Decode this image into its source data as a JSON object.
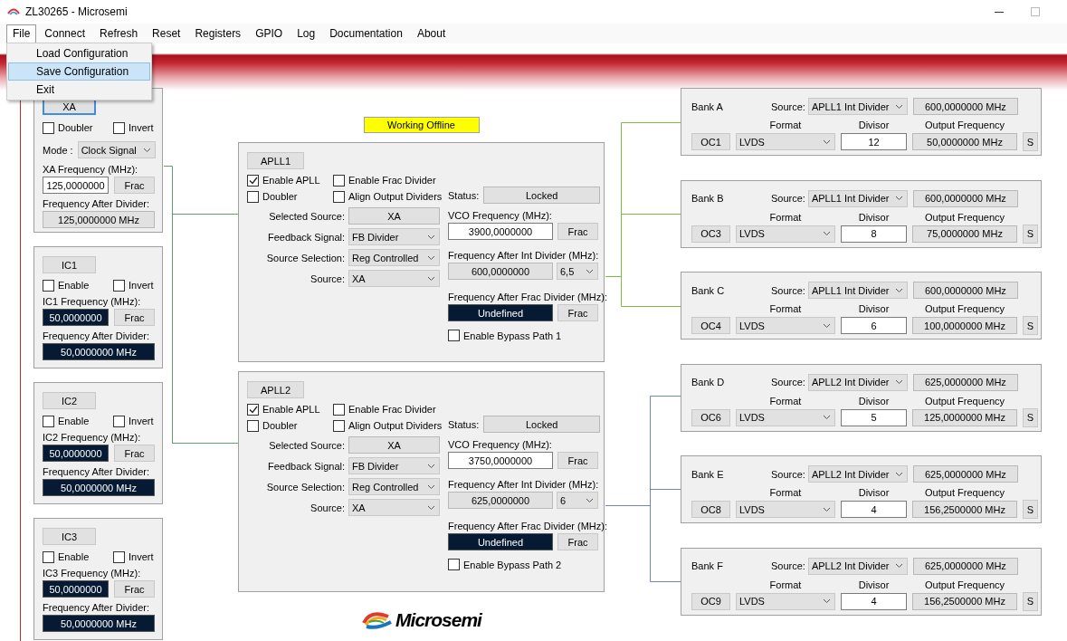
{
  "window": {
    "title": "ZL30265 - Microsemi"
  },
  "menu": [
    {
      "label": "File",
      "selected": true
    },
    {
      "label": "Connect",
      "selected": false
    },
    {
      "label": "Refresh",
      "selected": false
    },
    {
      "label": "Reset",
      "selected": false
    },
    {
      "label": "Registers",
      "selected": false
    },
    {
      "label": "GPIO",
      "selected": false
    },
    {
      "label": "Log",
      "selected": false
    },
    {
      "label": "Documentation",
      "selected": false
    },
    {
      "label": "About",
      "selected": false
    }
  ],
  "file_menu": {
    "items": [
      {
        "label": "Load Configuration",
        "selected": false
      },
      {
        "label": "Save Configuration",
        "selected": true
      },
      {
        "label": "Exit",
        "selected": false
      }
    ]
  },
  "status_badge": "Working Offline",
  "inputs": [
    {
      "kind": "crystal",
      "button": "XA",
      "focused": true,
      "checks": [
        {
          "label": "Doubler",
          "checked": false
        },
        {
          "label": "Invert",
          "checked": false
        }
      ],
      "mode_label": "Mode :",
      "mode": "Clock Signal",
      "freq_label": "XA Frequency (MHz):",
      "freq": "125,0000000",
      "frac": "Frac",
      "after_label": "Frequency After Divider:",
      "after": "125,0000000 MHz"
    },
    {
      "kind": "clock",
      "button": "IC1",
      "focused": false,
      "checks": [
        {
          "label": "Enable",
          "checked": false
        },
        {
          "label": "Invert",
          "checked": false
        }
      ],
      "freq_label": "IC1 Frequency (MHz):",
      "freq": "50,0000000",
      "frac": "Frac",
      "after_label": "Frequency After Divider:",
      "after": "50,0000000 MHz"
    },
    {
      "kind": "clock",
      "button": "IC2",
      "focused": false,
      "checks": [
        {
          "label": "Enable",
          "checked": false
        },
        {
          "label": "Invert",
          "checked": false
        }
      ],
      "freq_label": "IC2 Frequency (MHz):",
      "freq": "50,0000000",
      "frac": "Frac",
      "after_label": "Frequency After Divider:",
      "after": "50,0000000 MHz"
    },
    {
      "kind": "clock",
      "button": "IC3",
      "focused": false,
      "checks": [
        {
          "label": "Enable",
          "checked": false
        },
        {
          "label": "Invert",
          "checked": false
        }
      ],
      "freq_label": "IC3 Frequency (MHz):",
      "freq": "50,0000000",
      "frac": "Frac",
      "after_label": "Frequency After Divider:",
      "after": "50,0000000 MHz"
    }
  ],
  "aplls": [
    {
      "button": "APLL1",
      "checks": [
        {
          "label": "Enable APLL",
          "checked": true
        },
        {
          "label": "Enable Frac Divider",
          "checked": false
        },
        {
          "label": "Doubler",
          "checked": false
        },
        {
          "label": "Align Output Dividers",
          "checked": false
        }
      ],
      "rows": [
        {
          "kind": "readout",
          "label": "Selected Source:",
          "value": "XA"
        },
        {
          "kind": "dropdown",
          "label": "Feedback Signal:",
          "value": "FB Divider"
        },
        {
          "kind": "dropdown",
          "label": "Source Selection:",
          "value": "Reg Controlled"
        },
        {
          "kind": "dropdown",
          "label": "Source:",
          "value": "XA"
        }
      ],
      "status_label": "Status:",
      "status": "Locked",
      "vco_label": "VCO Frequency (MHz):",
      "vco": "3900,0000000",
      "vco_frac": "Frac",
      "int_label": "Frequency After Int Divider (MHz):",
      "int_value": "600,0000000",
      "int_divider": "6,5",
      "frac_label": "Frequency After Frac Divider (MHz):",
      "frac_value": "Undefined",
      "frac_button": "Frac",
      "bypass": {
        "label": "Enable Bypass Path 1",
        "checked": false
      }
    },
    {
      "button": "APLL2",
      "checks": [
        {
          "label": "Enable APLL",
          "checked": true
        },
        {
          "label": "Enable Frac Divider",
          "checked": false
        },
        {
          "label": "Doubler",
          "checked": false
        },
        {
          "label": "Align Output Dividers",
          "checked": false
        }
      ],
      "rows": [
        {
          "kind": "readout",
          "label": "Selected Source:",
          "value": "XA"
        },
        {
          "kind": "dropdown",
          "label": "Feedback Signal:",
          "value": "FB Divider"
        },
        {
          "kind": "dropdown",
          "label": "Source Selection:",
          "value": "Reg Controlled"
        },
        {
          "kind": "dropdown",
          "label": "Source:",
          "value": "XA"
        }
      ],
      "status_label": "Status:",
      "status": "Locked",
      "vco_label": "VCO Frequency (MHz):",
      "vco": "3750,0000000",
      "vco_frac": "Frac",
      "int_label": "Frequency After Int Divider (MHz):",
      "int_value": "625,0000000",
      "int_divider": "6",
      "frac_label": "Frequency After Frac Divider (MHz):",
      "frac_value": "Undefined",
      "frac_button": "Frac",
      "bypass": {
        "label": "Enable Bypass Path 2",
        "checked": false
      }
    }
  ],
  "logo": "Microsemi",
  "banks": [
    {
      "name": "Bank A",
      "source_label": "Source:",
      "source": "APLL1 Int Divider",
      "source_freq": "600,0000000 MHz",
      "format_label": "Format",
      "divisor_label": "Divisor",
      "output_label": "Output Frequency",
      "output": "OC1",
      "format": "LVDS",
      "divisor": "12",
      "output_freq": "50,0000000 MHz",
      "s": "S"
    },
    {
      "name": "Bank B",
      "source_label": "Source:",
      "source": "APLL1 Int Divider",
      "source_freq": "600,0000000 MHz",
      "format_label": "Format",
      "divisor_label": "Divisor",
      "output_label": "Output Frequency",
      "output": "OC3",
      "format": "LVDS",
      "divisor": "8",
      "output_freq": "75,0000000 MHz",
      "s": "S"
    },
    {
      "name": "Bank C",
      "source_label": "Source:",
      "source": "APLL1 Int Divider",
      "source_freq": "600,0000000 MHz",
      "format_label": "Format",
      "divisor_label": "Divisor",
      "output_label": "Output Frequency",
      "output": "OC4",
      "format": "LVDS",
      "divisor": "6",
      "output_freq": "100,0000000 MHz",
      "s": "S"
    },
    {
      "name": "Bank D",
      "source_label": "Source:",
      "source": "APLL2 Int Divider",
      "source_freq": "625,0000000 MHz",
      "format_label": "Format",
      "divisor_label": "Divisor",
      "output_label": "Output Frequency",
      "output": "OC6",
      "format": "LVDS",
      "divisor": "5",
      "output_freq": "125,0000000 MHz",
      "s": "S"
    },
    {
      "name": "Bank E",
      "source_label": "Source:",
      "source": "APLL2 Int Divider",
      "source_freq": "625,0000000 MHz",
      "format_label": "Format",
      "divisor_label": "Divisor",
      "output_label": "Output Frequency",
      "output": "OC8",
      "format": "LVDS",
      "divisor": "4",
      "output_freq": "156,2500000 MHz",
      "s": "S"
    },
    {
      "name": "Bank F",
      "source_label": "Source:",
      "source": "APLL2 Int Divider",
      "source_freq": "625,0000000 MHz",
      "format_label": "Format",
      "divisor_label": "Divisor",
      "output_label": "Output Frequency",
      "output": "OC9",
      "format": "LVDS",
      "divisor": "4",
      "output_freq": "156,2500000 MHz",
      "s": "S"
    }
  ]
}
